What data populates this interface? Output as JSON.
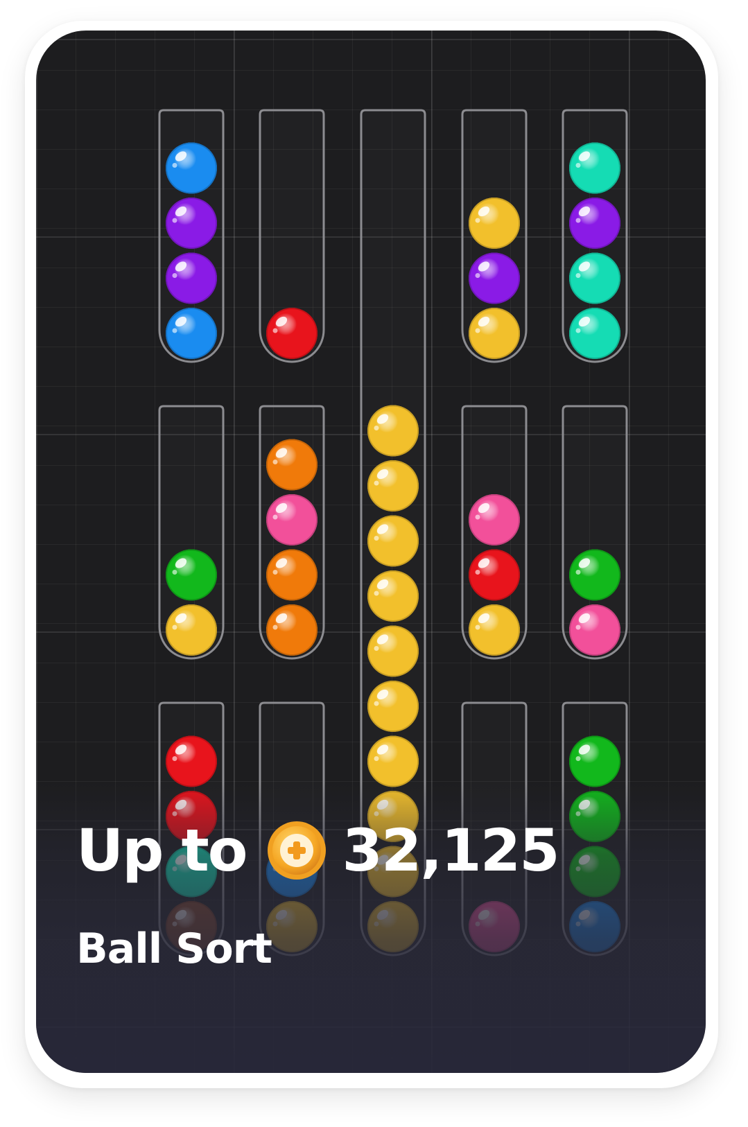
{
  "card": {
    "reward_prefix": "Up to",
    "reward_amount": "32,125",
    "coin_icon": "coin-plus-icon",
    "title": "Ball Sort"
  },
  "palette": {
    "blue": "#1a8cf0",
    "purple": "#8a1be6",
    "red": "#e8141c",
    "yellow": "#f2c02c",
    "teal": "#15dcb4",
    "green": "#12b81c",
    "orange": "#f07a0a",
    "pink": "#f2509a",
    "brown": "#8a4a2c"
  },
  "board": {
    "tubes": [
      {
        "id": "t1",
        "balls": [
          "blue",
          "purple",
          "purple",
          "blue"
        ]
      },
      {
        "id": "t2",
        "balls": [
          "red"
        ]
      },
      {
        "id": "t3",
        "balls": [
          "yellow",
          "yellow",
          "yellow",
          "yellow",
          "yellow",
          "yellow",
          "yellow",
          "yellow",
          "yellow",
          "yellow"
        ]
      },
      {
        "id": "t4",
        "balls": [
          "yellow",
          "purple",
          "yellow"
        ]
      },
      {
        "id": "t5",
        "balls": [
          "teal",
          "purple",
          "teal",
          "teal"
        ]
      },
      {
        "id": "t6",
        "balls": [
          "green",
          "yellow"
        ]
      },
      {
        "id": "t7",
        "balls": [
          "orange",
          "pink",
          "orange",
          "orange"
        ]
      },
      {
        "id": "t8",
        "balls": [
          "pink",
          "red",
          "yellow"
        ]
      },
      {
        "id": "t9",
        "balls": [
          "green",
          "pink"
        ]
      },
      {
        "id": "t10",
        "balls": [
          "red",
          "red",
          "teal",
          "brown"
        ]
      },
      {
        "id": "t11",
        "balls": [
          "blue",
          "yellow"
        ]
      },
      {
        "id": "t12",
        "balls": [
          "pink"
        ]
      },
      {
        "id": "t13",
        "balls": [
          "green",
          "green",
          "green",
          "blue"
        ]
      }
    ]
  }
}
